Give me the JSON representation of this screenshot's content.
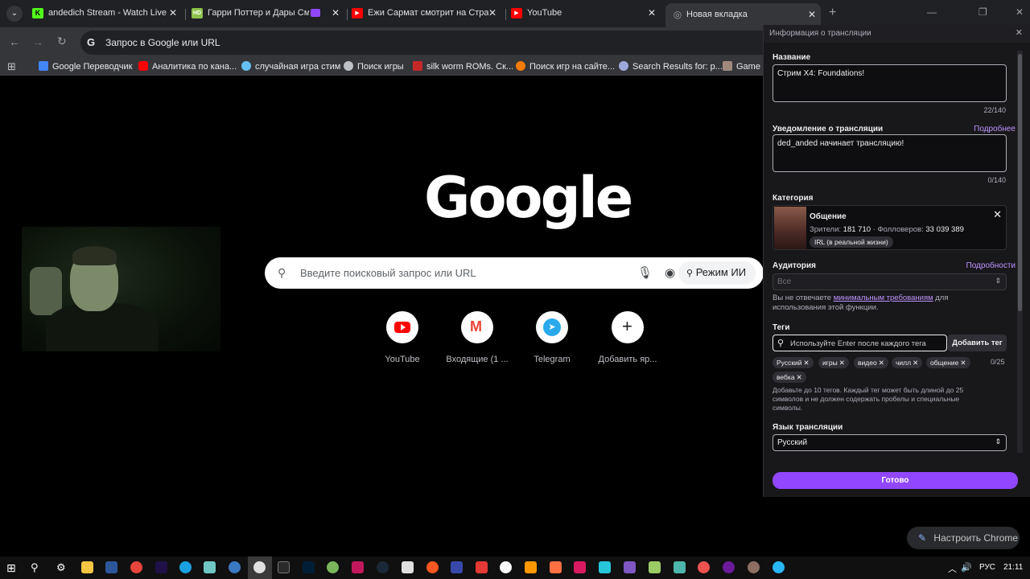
{
  "tabs": [
    {
      "title": "andedich Stream - Watch Live o",
      "icon": "kick-icon",
      "color": "#53fc18",
      "glyph": "K"
    },
    {
      "title": "Гарри Поттер и Дары Смер",
      "icon": "hd-video-icon",
      "color": "#8bc34a",
      "glyph": "HD"
    },
    {
      "title": "Ежи Сармат смотрит на Страд",
      "icon": "youtube-icon",
      "color": "#ff0000",
      "glyph": "▶"
    },
    {
      "title": "YouTube",
      "icon": "youtube-icon",
      "color": "#ff0000",
      "glyph": "▶"
    },
    {
      "title": "Новая вкладка",
      "icon": "chrome-icon",
      "color": "#9aa0a6",
      "glyph": "◎"
    }
  ],
  "omnibox": {
    "placeholder": "Запрос в Google или URL"
  },
  "bookmarks": [
    {
      "label": "Google Переводчик",
      "icon": "google-translate-icon",
      "color": "#4285f4"
    },
    {
      "label": "Аналитика по кана...",
      "icon": "youtube-icon",
      "color": "#ff0000"
    },
    {
      "label": "случайная игра стим",
      "icon": "steam-icon",
      "color": "#66c0f4"
    },
    {
      "label": "Поиск игры",
      "icon": "globe-icon",
      "color": "#bdc1c6"
    },
    {
      "label": "silk worm ROMs. Ск...",
      "icon": "bookmark-page-icon",
      "color": "#c62828"
    },
    {
      "label": "Поиск игр на сайте...",
      "icon": "game-site-icon",
      "color": "#f57c00"
    },
    {
      "label": "Search Results for: p...",
      "icon": "search-site-icon",
      "color": "#9fa8da"
    },
    {
      "label": "Game p",
      "icon": "game-icon",
      "color": "#a1887f"
    }
  ],
  "ntp": {
    "logo": "Google",
    "search_placeholder": "Введите поисковый запрос или URL",
    "ai_mode": "Режим ИИ",
    "shortcuts": [
      {
        "label": "YouTube",
        "icon": "youtube-icon"
      },
      {
        "label": "Входящие (1 ...",
        "icon": "gmail-icon"
      },
      {
        "label": "Telegram",
        "icon": "telegram-icon"
      },
      {
        "label": "Добавить яр...",
        "icon": "plus-icon"
      }
    ],
    "customize": "Настроить Chrome"
  },
  "panel": {
    "header": "Информация о трансляции",
    "title_label": "Название",
    "title_value": "Стрим X4: Foundations!",
    "title_count": "22/140",
    "notify_label": "Уведомление о трансляции",
    "notify_link": "Подробнее",
    "notify_value": "ded_anded начинает трансляцию!",
    "notify_count": "0/140",
    "category_label": "Категория",
    "category": {
      "name": "Общение",
      "viewers_label": "Зрители:",
      "viewers": "181 710",
      "followers_label": "· Фолловеров:",
      "followers": "33 039 389",
      "tag": "IRL (в реальной жизни)"
    },
    "audience_label": "Аудитория",
    "audience_link": "Подробности",
    "audience_value": "Все",
    "audience_note_pre": "Вы не отвечаете ",
    "audience_note_link": "минимальным требованиям",
    "audience_note_post": " для использования этой функции.",
    "tags_label": "Теги",
    "tags_placeholder": "Используйте Enter после каждого тега",
    "tags_add": "Добавить тег",
    "tags_count": "0/25",
    "tags": [
      "Русский",
      "игры",
      "видео",
      "чилл",
      "общение",
      "вебка"
    ],
    "tags_help": "Добавьте до 10 тегов. Каждый тег может быть длиной до 25 символов и не должен содержать пробелы и специальные символы.",
    "lang_label": "Язык трансляции",
    "lang_value": "Русский",
    "done": "Готово"
  },
  "taskbar": {
    "lang": "РУС",
    "time": "21:11"
  }
}
